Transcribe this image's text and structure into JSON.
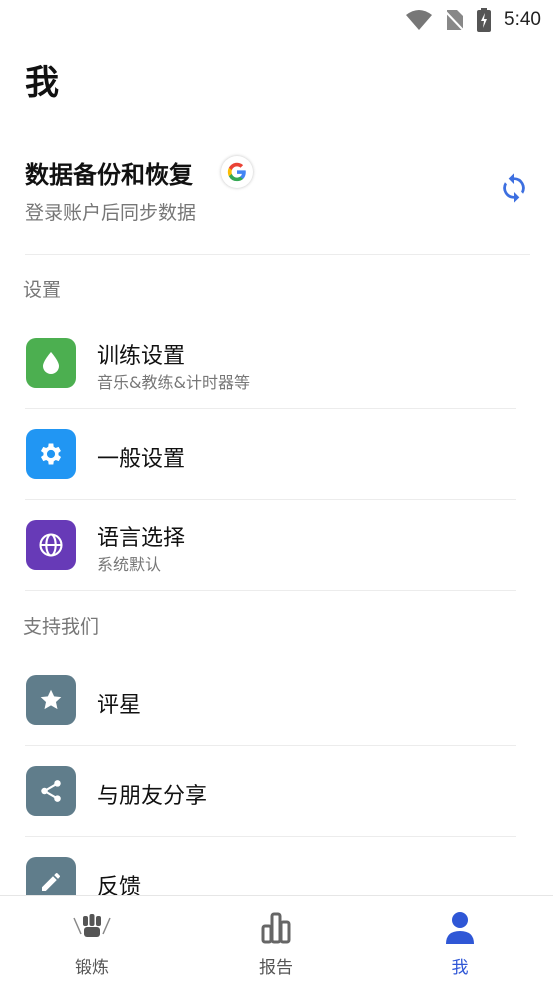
{
  "status_bar": {
    "time": "5:40"
  },
  "page": {
    "title": "我"
  },
  "backup": {
    "title": "数据备份和恢复",
    "subtitle": "登录账户后同步数据"
  },
  "sections": {
    "settings_header": "设置",
    "support_header": "支持我们"
  },
  "settings_items": [
    {
      "title": "训练设置",
      "subtitle": "音乐&教练&计时器等",
      "icon": "drop-icon",
      "color": "#4caf50"
    },
    {
      "title": "一般设置",
      "icon": "gear-icon",
      "color": "#2196f3"
    },
    {
      "title": "语言选择",
      "subtitle": "系统默认",
      "icon": "globe-icon",
      "color": "#673ab7"
    }
  ],
  "support_items": [
    {
      "title": "评星",
      "icon": "star-icon",
      "color": "#607d8b"
    },
    {
      "title": "与朋友分享",
      "icon": "share-icon",
      "color": "#607d8b"
    },
    {
      "title": "反馈",
      "icon": "pencil-icon",
      "color": "#607d8b"
    }
  ],
  "bottom_nav": [
    {
      "label": "锻炼",
      "icon": "workout-icon",
      "active": false
    },
    {
      "label": "报告",
      "icon": "chart-icon",
      "active": false
    },
    {
      "label": "我",
      "icon": "person-icon",
      "active": true
    }
  ],
  "colors": {
    "accent": "#2f57d6",
    "sync": "#3d6fe0"
  }
}
